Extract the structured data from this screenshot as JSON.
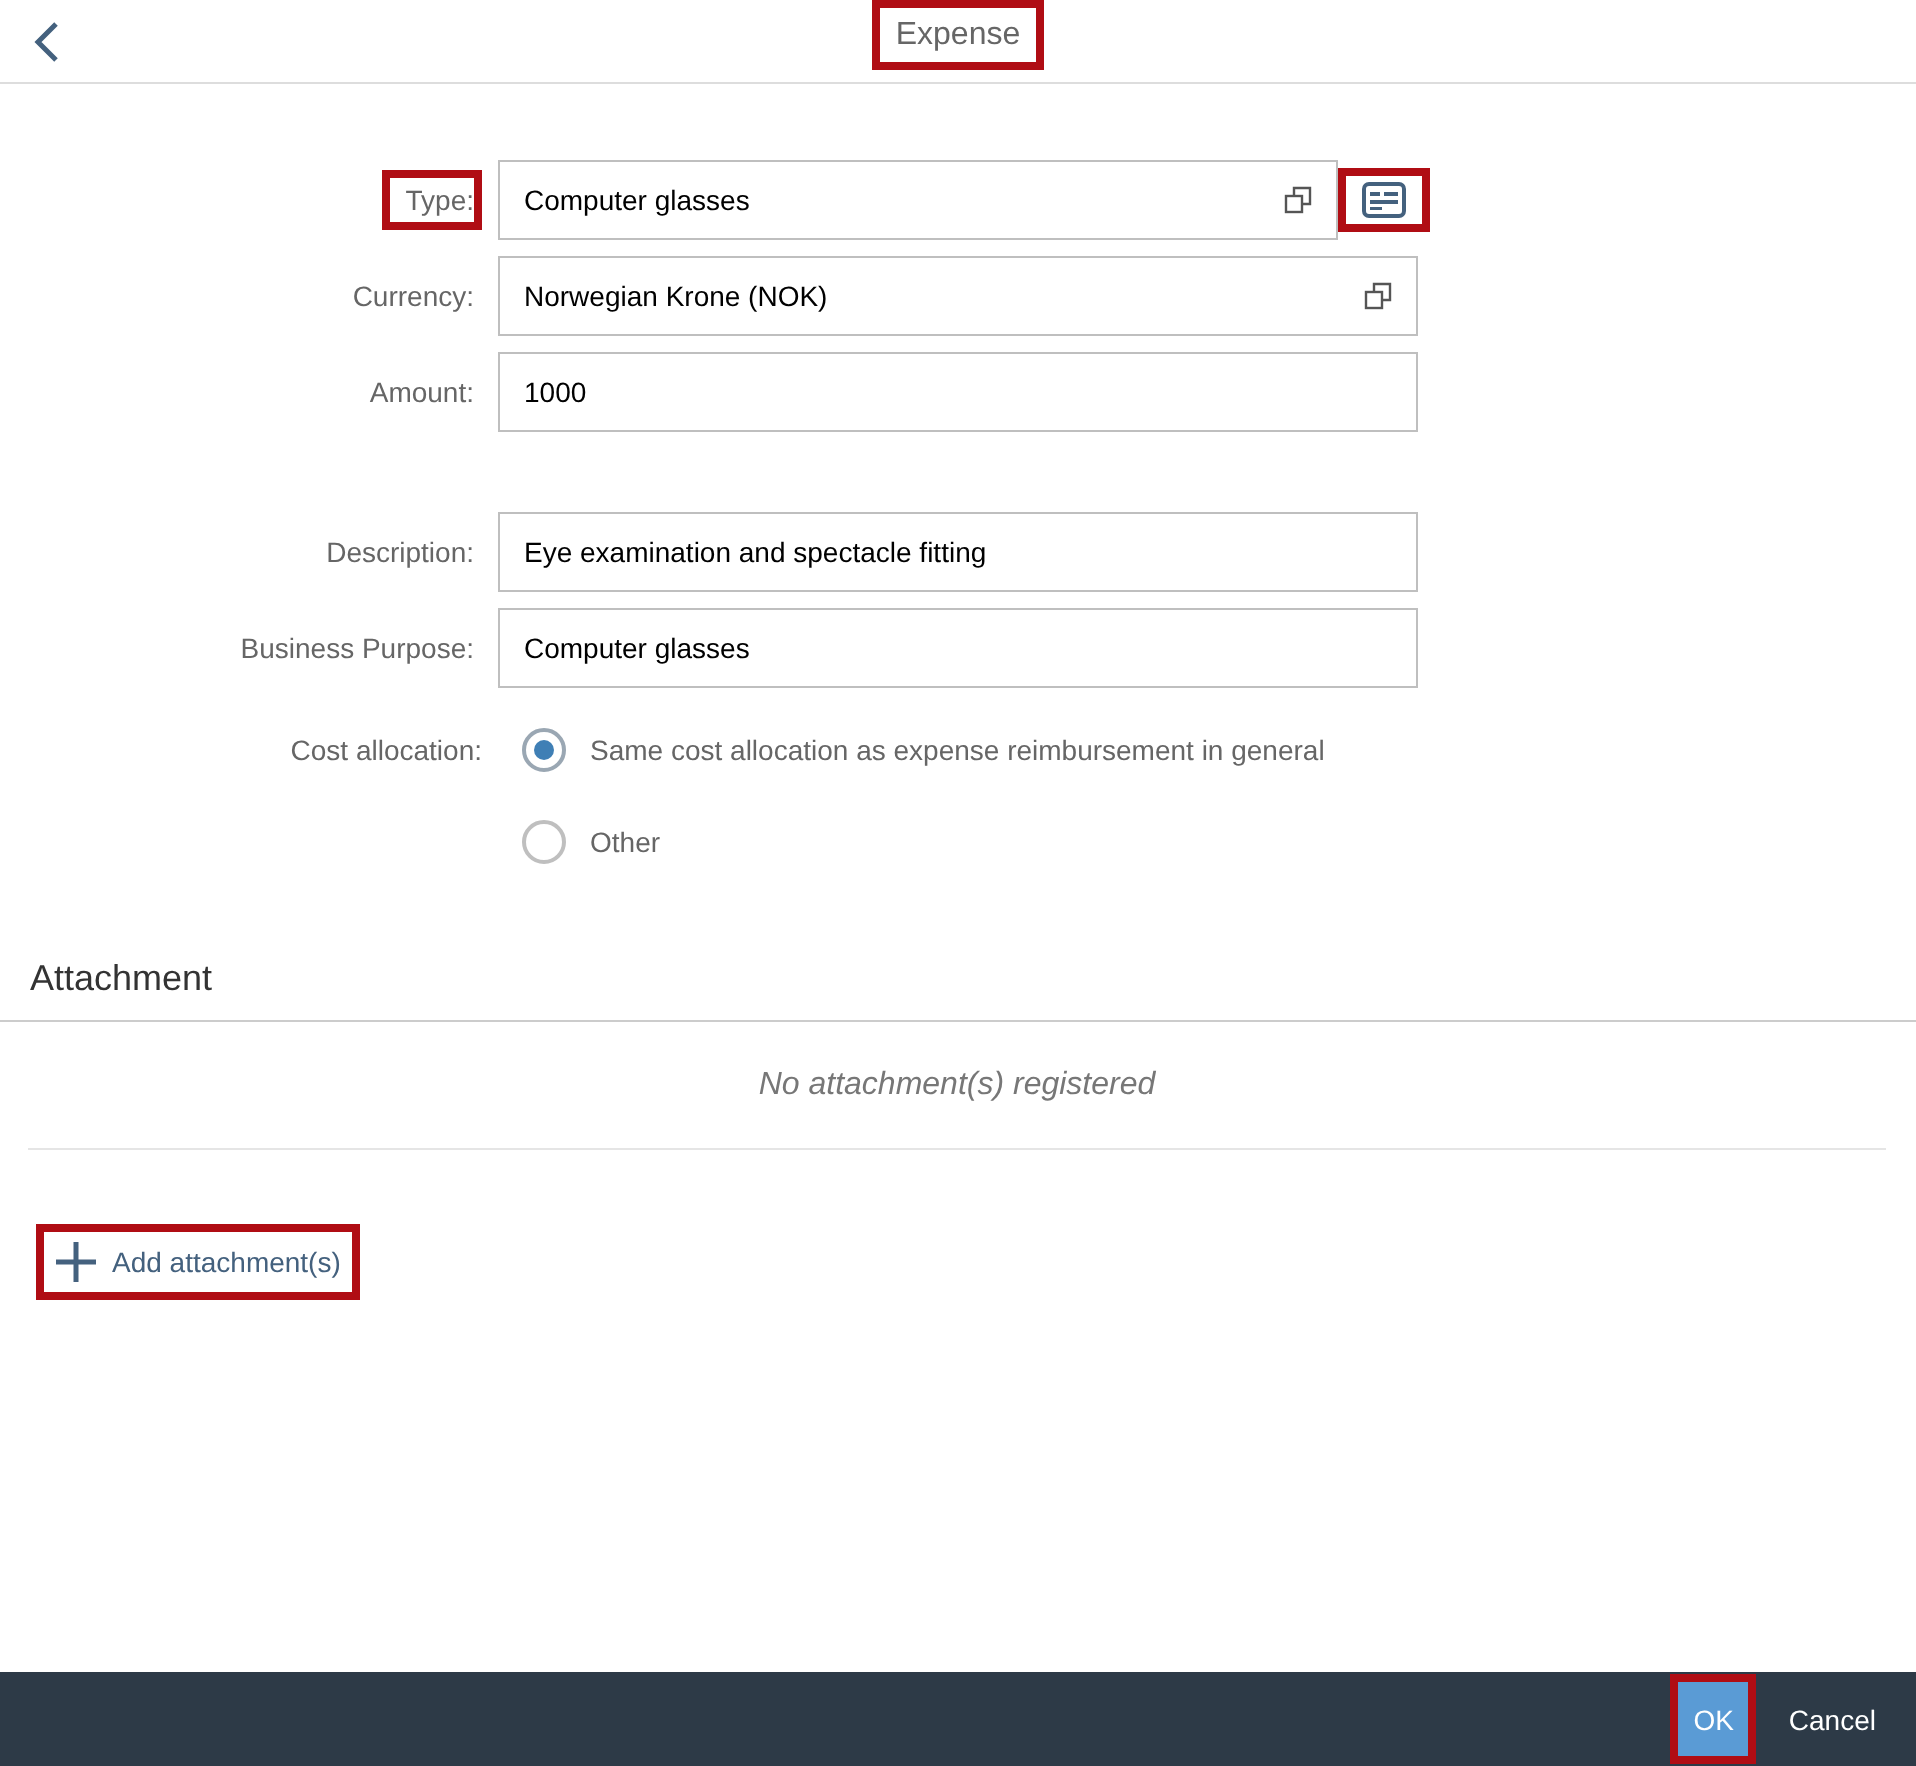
{
  "header": {
    "title": "Expense",
    "title_highlighted": true
  },
  "form": {
    "groups": [
      [
        {
          "kind": "select_with_details",
          "label": "Type:",
          "label_highlighted": true,
          "value": "Computer glasses",
          "details_highlighted": true
        },
        {
          "kind": "select",
          "label": "Currency:",
          "label_highlighted": false,
          "value": "Norwegian Krone (NOK)"
        },
        {
          "kind": "text",
          "label": "Amount:",
          "label_highlighted": false,
          "value": "1000"
        }
      ],
      [
        {
          "kind": "text",
          "label": "Description:",
          "label_highlighted": false,
          "value": "Eye examination and spectacle fitting"
        },
        {
          "kind": "text",
          "label": "Business Purpose:",
          "label_highlighted": false,
          "value": "Computer glasses"
        }
      ]
    ]
  },
  "cost_allocation": {
    "label": "Cost allocation:",
    "options": [
      {
        "label": "Same cost allocation as expense reimbursement in general",
        "selected": true
      },
      {
        "label": "Other",
        "selected": false
      }
    ]
  },
  "attachment": {
    "title": "Attachment",
    "empty_text": "No attachment(s) registered",
    "add_button": {
      "label": "Add attachment(s)",
      "highlighted": true
    }
  },
  "footer": {
    "buttons": [
      {
        "label": "OK",
        "kind": "primary",
        "highlighted": true
      },
      {
        "label": "Cancel",
        "kind": "plain",
        "highlighted": false
      }
    ]
  }
}
